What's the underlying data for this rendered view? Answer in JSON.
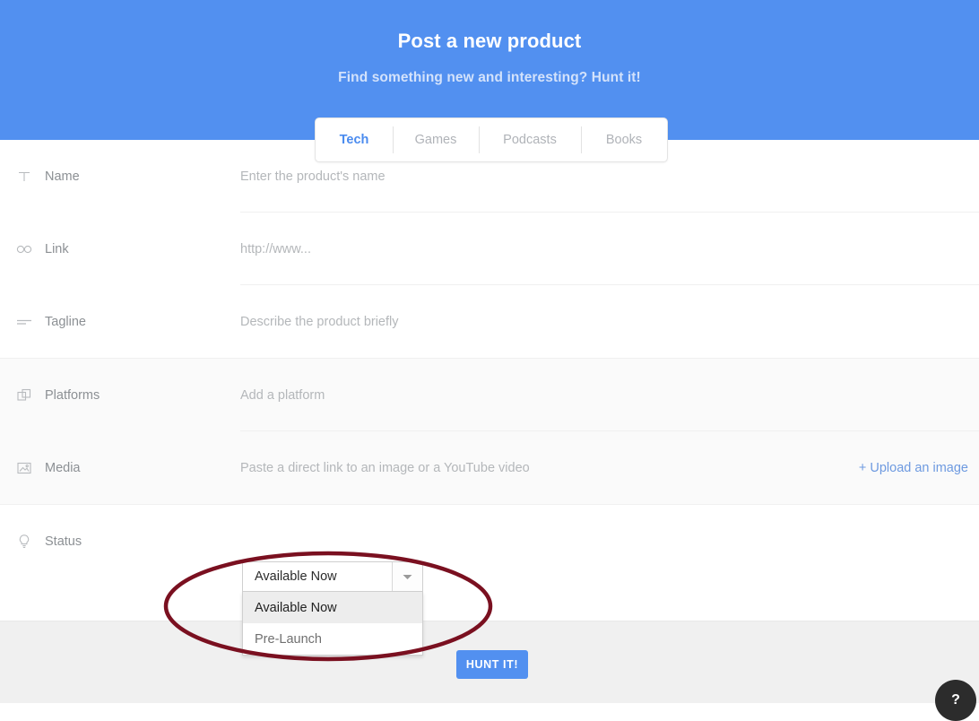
{
  "header": {
    "title": "Post a new product",
    "subtitle": "Find something new and interesting? Hunt it!",
    "accent_color": "#5290f0"
  },
  "tabs": [
    {
      "label": "Tech",
      "active": true
    },
    {
      "label": "Games",
      "active": false
    },
    {
      "label": "Podcasts",
      "active": false
    },
    {
      "label": "Books",
      "active": false
    }
  ],
  "form": {
    "rows": [
      {
        "icon": "text-format-icon",
        "label": "Name",
        "placeholder": "Enter the product's name"
      },
      {
        "icon": "link-icon",
        "label": "Link",
        "placeholder": "http://www..."
      },
      {
        "icon": "tagline-icon",
        "label": "Tagline",
        "placeholder": "Describe the product briefly"
      },
      {
        "icon": "platforms-icon",
        "label": "Platforms",
        "placeholder": "Add a platform"
      },
      {
        "icon": "media-icon",
        "label": "Media",
        "placeholder": "Paste a direct link to an image or a YouTube video",
        "action": "+ Upload an image"
      },
      {
        "icon": "lightbulb-icon",
        "label": "Status",
        "placeholder": ""
      }
    ]
  },
  "status_select": {
    "value": "Available Now",
    "options": [
      {
        "label": "Available Now",
        "highlighted": true
      },
      {
        "label": "Pre-Launch",
        "highlighted": false
      }
    ]
  },
  "footer": {
    "submit_label": "HUNT IT!"
  },
  "help": {
    "label": "?"
  },
  "annotation": {
    "shape": "ellipse",
    "color": "#7a1020"
  }
}
